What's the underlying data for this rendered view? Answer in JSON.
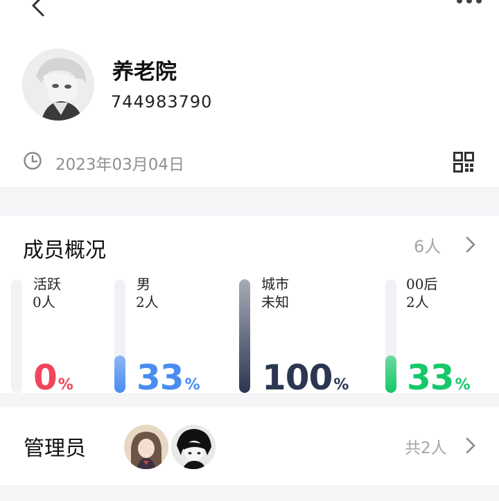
{
  "header": {
    "back_icon": "chevron-left-icon",
    "more_icon": "more-dots-icon"
  },
  "group": {
    "name": "养老院",
    "id": "744983790",
    "created_date": "2023年03月04日",
    "clock_icon": "clock-icon",
    "qr_icon": "qr-code-icon"
  },
  "members": {
    "title": "成员概况",
    "count": "6人",
    "stats": [
      {
        "line1": "活跃",
        "line2": "0人",
        "value": "0",
        "unit": "%",
        "fraction": 0.0,
        "color": "#f0455b"
      },
      {
        "line1": "男",
        "line2": "2人",
        "value": "33",
        "unit": "%",
        "fraction": 0.33,
        "color": "#4a8cf0"
      },
      {
        "line1": "城市",
        "line2": "未知",
        "value": "100",
        "unit": "%",
        "fraction": 1.0,
        "color": "#2c3650"
      },
      {
        "line1": "00后",
        "line2": "2人",
        "value": "33",
        "unit": "%",
        "fraction": 0.33,
        "color": "#15c86a"
      }
    ]
  },
  "admins": {
    "label": "管理员",
    "total": "共2人"
  }
}
